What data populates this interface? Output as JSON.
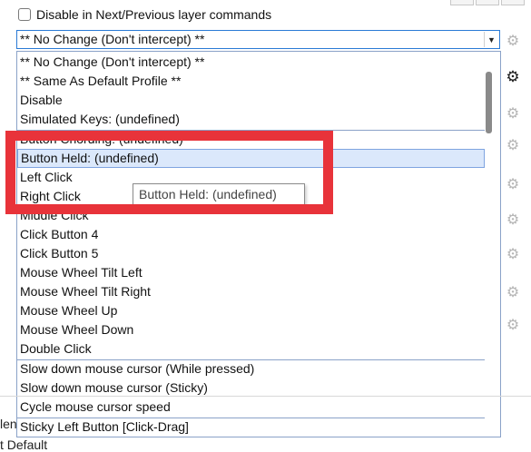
{
  "top": {
    "checkbox_label": "Disable in Next/Previous layer commands"
  },
  "combo": {
    "value": "** No Change (Don't intercept) **"
  },
  "list": {
    "items": [
      "** No Change (Don't intercept) **",
      "** Same As Default Profile **",
      "Disable",
      "Simulated Keys: (undefined)",
      "Button Chording: (undefined)",
      "Button Held: (undefined)",
      "Left Click",
      "Right Click",
      "Middle Click",
      "Click Button 4",
      "Click Button 5",
      "Mouse Wheel Tilt Left",
      "Mouse Wheel Tilt Right",
      "Mouse Wheel Up",
      "Mouse Wheel Down",
      "Double Click",
      "Slow down mouse cursor (While pressed)",
      "Slow down mouse cursor (Sticky)",
      "Cycle mouse cursor speed",
      "Sticky Left Button [Click-Drag]"
    ],
    "selected_index": 5
  },
  "tooltip": {
    "text": "Button Held: (undefined)"
  },
  "edge": {
    "left_fragment_1": "len",
    "left_fragment_2": "t Default"
  },
  "colors": {
    "highlight_box": "#e8333a",
    "selection_bg": "#dbe8fb",
    "focus_border": "#2a7ad5"
  },
  "icons": {
    "checkbox": "checkbox-unchecked-icon",
    "dropdown": "chevron-down-icon",
    "settings": "gear-icon"
  }
}
